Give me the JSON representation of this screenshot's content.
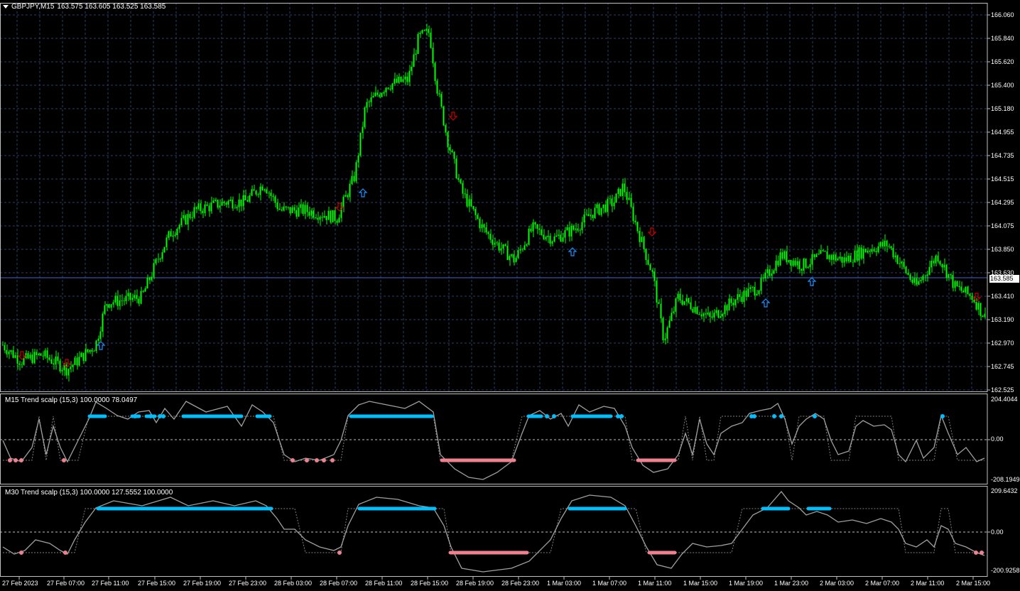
{
  "main": {
    "symbol": "GBPJPY,M15",
    "ohlc": "163.575 163.605 163.525 163.585",
    "current_price": "163.585",
    "price_labels": [
      "166.060",
      "165.840",
      "165.620",
      "165.400",
      "165.180",
      "164.955",
      "164.735",
      "164.515",
      "164.295",
      "164.075",
      "163.850",
      "163.630",
      "163.410",
      "163.190",
      "162.970",
      "162.745",
      "162.525"
    ],
    "colors": {
      "candles": "#00ff00",
      "grid": "#2c3e66",
      "up_arrow": "#1e90ff",
      "down_arrow": "#cc0000",
      "bid_line": "#4a66c8"
    }
  },
  "indicator1": {
    "title": "M15 Trend scalp (15,3) 100.0000 78.0497",
    "max_label": "204.4044",
    "mid_label": "0.00",
    "min_label": "-208.1949"
  },
  "indicator2": {
    "title": "M30 Trend scalp (15,3) 100.0000 127.5552 100.0000",
    "max_label": "209.6432",
    "mid_label": "0.00",
    "min_label": "-200.9258"
  },
  "time_labels": [
    "27 Feb 2023",
    "27 Feb 07:00",
    "27 Feb 11:00",
    "27 Feb 15:00",
    "27 Feb 19:00",
    "27 Feb 23:00",
    "28 Feb 03:00",
    "28 Feb 07:00",
    "28 Feb 11:00",
    "28 Feb 15:00",
    "28 Feb 19:00",
    "28 Feb 23:00",
    "1 Mar 03:00",
    "1 Mar 07:00",
    "1 Mar 11:00",
    "1 Mar 15:00",
    "1 Mar 19:00",
    "1 Mar 23:00",
    "2 Mar 03:00",
    "2 Mar 07:00",
    "2 Mar 11:00",
    "2 Mar 15:00"
  ],
  "indicator_colors": {
    "osc": "#a0a0a0",
    "bull": "#00bfff",
    "bear": "#f08090",
    "signal": "#808080"
  }
}
